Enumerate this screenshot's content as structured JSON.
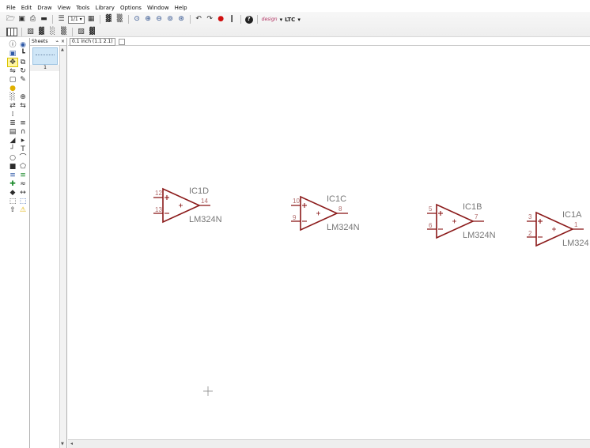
{
  "menu": [
    "File",
    "Edit",
    "Draw",
    "View",
    "Tools",
    "Library",
    "Options",
    "Window",
    "Help"
  ],
  "toolbar": {
    "page_select_value": "1/1",
    "brand_left": "design",
    "brand_right": "LTC"
  },
  "sheets_panel": {
    "title": "Sheets",
    "pin_glyph": "⌁",
    "close_glyph": "×",
    "sheet_number": "1"
  },
  "document_tab": {
    "label": "0.1 inch (1.1 2.1)"
  },
  "components": [
    {
      "ref": "IC1D",
      "part": "LM324N",
      "pin_in_top": "12",
      "pin_in_bottom": "13",
      "pin_out": "14"
    },
    {
      "ref": "IC1C",
      "part": "LM324N",
      "pin_in_top": "10",
      "pin_in_bottom": "9",
      "pin_out": "8"
    },
    {
      "ref": "IC1B",
      "part": "LM324N",
      "pin_in_top": "5",
      "pin_in_bottom": "6",
      "pin_out": "7"
    },
    {
      "ref": "IC1A",
      "part": "LM324",
      "pin_in_top": "3",
      "pin_in_bottom": "2",
      "pin_out": "1"
    }
  ],
  "colors": {
    "schematic_symbol": "#8b1a1a",
    "pin_number": "#b06b6b",
    "label_text": "#777777",
    "selected_tool_bg": "#fff5a0"
  }
}
